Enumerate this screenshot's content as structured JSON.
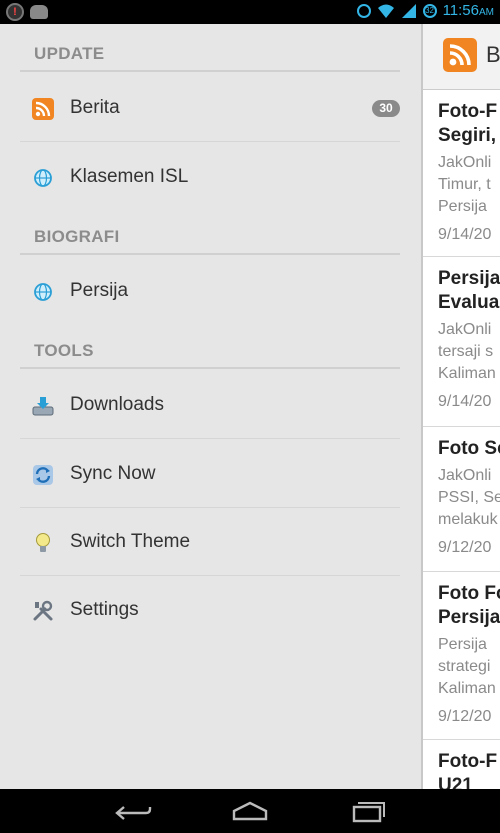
{
  "status_bar": {
    "time": "11:56",
    "am_pm": "AM",
    "battery_level": "32"
  },
  "drawer": {
    "sections": [
      {
        "title": "UPDATE"
      },
      {
        "title": "BIOGRAFI"
      },
      {
        "title": "TOOLS"
      }
    ],
    "items": [
      {
        "label": "Berita",
        "icon": "rss-icon",
        "badge": "30"
      },
      {
        "label": "Klasemen ISL",
        "icon": "globe-icon"
      },
      {
        "label": "Persija",
        "icon": "globe-icon"
      },
      {
        "label": "Downloads",
        "icon": "download-icon"
      },
      {
        "label": "Sync Now",
        "icon": "sync-icon"
      },
      {
        "label": "Switch Theme",
        "icon": "lightbulb-icon"
      },
      {
        "label": "Settings",
        "icon": "settings-icon"
      }
    ]
  },
  "content": {
    "title": "B",
    "articles": [
      {
        "title": [
          "Foto-F",
          "Segiri,"
        ],
        "snippet": [
          "JakOnli",
          "Timur, t",
          "Persija"
        ],
        "date": "9/14/20"
      },
      {
        "title": [
          "Persija",
          "Evaluas"
        ],
        "snippet": [
          "JakOnli",
          "tersaji s",
          "Kaliman"
        ],
        "date": "9/14/20"
      },
      {
        "title": [
          "Foto Se"
        ],
        "snippet": [
          "JakOnli",
          "PSSI, Se",
          "melakuk"
        ],
        "date": "9/12/20"
      },
      {
        "title": [
          "Foto Fo",
          "Persija"
        ],
        "snippet": [
          "Persija",
          "strategi",
          "Kaliman"
        ],
        "date": "9/12/20"
      },
      {
        "title": [
          "Foto-F",
          "U21"
        ],
        "snippet": [],
        "date": ""
      }
    ]
  },
  "colors": {
    "accent": "#33b5e5",
    "rss_orange": "#f08521",
    "drawer_bg": "#e6e6e6",
    "section_text": "#8c8c8c"
  }
}
